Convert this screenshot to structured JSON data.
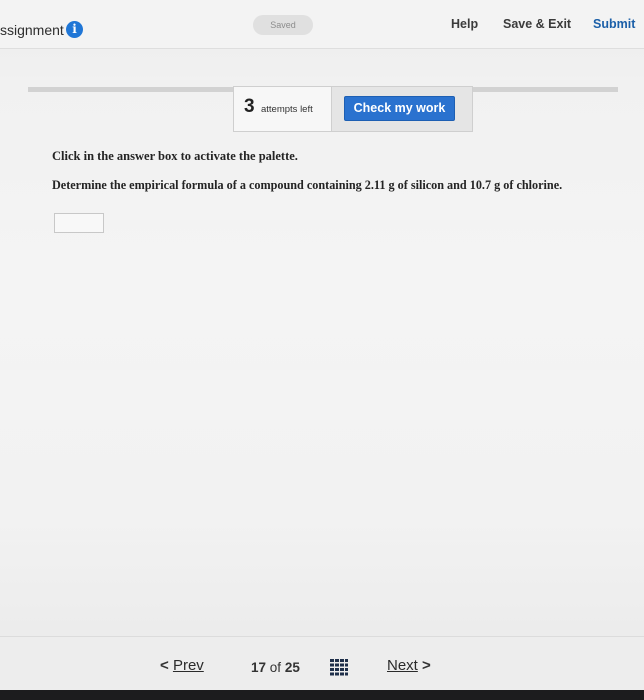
{
  "header": {
    "app_title": "ssignment",
    "saved_badge": "Saved",
    "help": "Help",
    "save_exit": "Save & Exit",
    "submit": "Submit",
    "info_icon": "i"
  },
  "attempts": {
    "count": "3",
    "label": "attempts left",
    "check_button": "Check my work"
  },
  "question": {
    "instruction": "Click in the answer box to activate the palette.",
    "text": "Determine the empirical formula of a compound containing 2.11 g of silicon and 10.7 g of chlorine.",
    "answer_value": ""
  },
  "footer": {
    "prev_chevron": "<",
    "prev": "Prev",
    "current_page": "17",
    "of": "of",
    "total_pages": "25",
    "next": "Next",
    "next_chevron": ">",
    "grid_icon": "grid-icon"
  },
  "colors": {
    "accent": "#2a72cf",
    "info_icon": "#1f76d6",
    "submit_text": "#1b5fa8"
  }
}
